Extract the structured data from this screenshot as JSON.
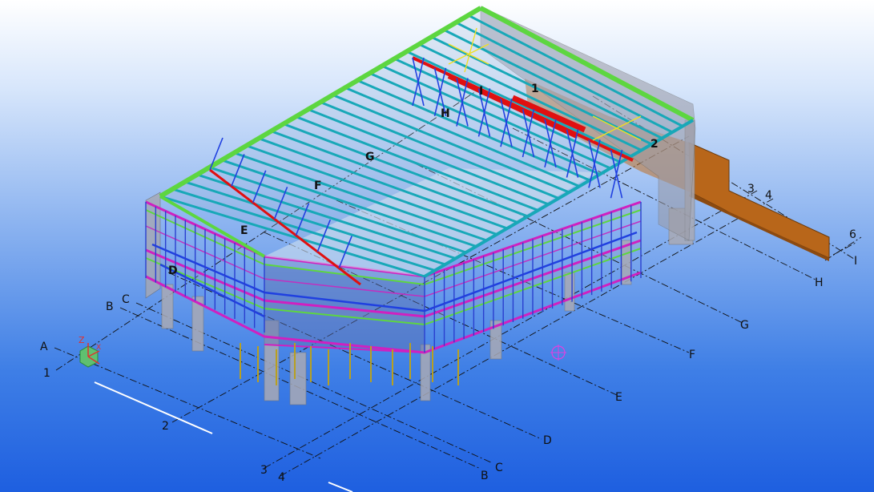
{
  "grid_labels": {
    "A": "A",
    "B": "B",
    "C": "C",
    "D": "D",
    "E": "E",
    "F": "F",
    "G": "G",
    "H": "H",
    "I": "I",
    "n1": "1",
    "n2": "2",
    "n3": "3",
    "n4": "4",
    "n6": "6"
  },
  "model_labels": {
    "D": "D",
    "E": "E",
    "F": "F",
    "G": "G",
    "H": "H",
    "I": "I",
    "n1": "1",
    "n2": "2"
  },
  "axis": {
    "z": "Z",
    "x": "X"
  },
  "colors": {
    "background_top": "#ffffff",
    "background_bottom": "#1e5fe0",
    "roof_beam": "#18a8b8",
    "edge_beam": "#5dd640",
    "ring_beam": "#d020c0",
    "truss": "#2040e0",
    "girder": "#e01010",
    "bracing": "#f0e020",
    "concrete": "#b8b8c0",
    "annex": "#b8661a"
  }
}
